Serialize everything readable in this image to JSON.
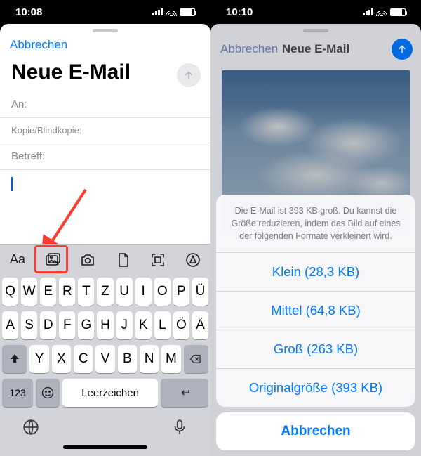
{
  "left": {
    "status_time": "10:08",
    "cancel": "Abbrechen",
    "title": "Neue E-Mail",
    "to_label": "An:",
    "cc_label": "Kopie/Blindkopie:",
    "subject_label": "Betreff:",
    "toolbar": {
      "aa": "Aa"
    },
    "keyboard": {
      "row1": [
        "Q",
        "W",
        "E",
        "R",
        "T",
        "Z",
        "U",
        "I",
        "O",
        "P",
        "Ü"
      ],
      "row2": [
        "A",
        "S",
        "D",
        "F",
        "G",
        "H",
        "J",
        "K",
        "L",
        "Ö",
        "Ä"
      ],
      "row3": [
        "Y",
        "X",
        "C",
        "V",
        "B",
        "N",
        "M"
      ],
      "numkey": "123",
      "space": "Leerzeichen"
    }
  },
  "right": {
    "status_time": "10:10",
    "cancel": "Abbrechen",
    "title": "Neue E-Mail",
    "sheet_message": "Die E-Mail ist 393 KB groß. Du kannst die Größe reduzieren, indem das Bild auf eines der folgenden Formate verkleinert wird.",
    "options": [
      "Klein (28,3 KB)",
      "Mittel (64,8 KB)",
      "Groß (263 KB)",
      "Originalgröße (393 KB)"
    ],
    "sheet_cancel": "Abbrechen"
  }
}
